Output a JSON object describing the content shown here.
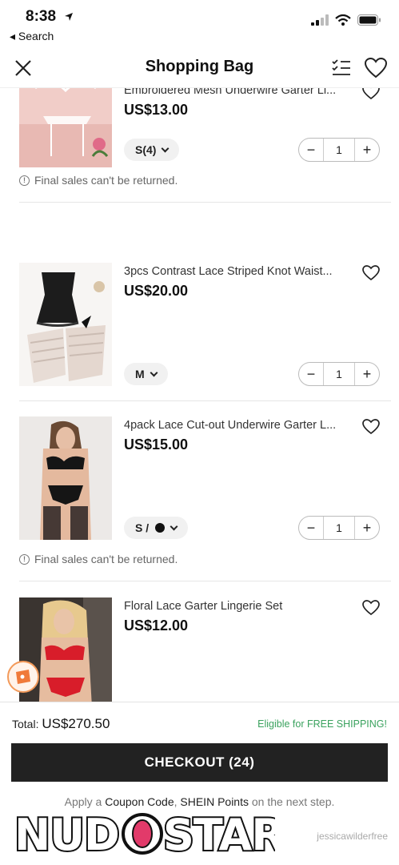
{
  "status_bar": {
    "time": "8:38",
    "back_label": "◂ Search"
  },
  "header": {
    "title": "Shopping Bag"
  },
  "items": [
    {
      "name": "Embroidered Mesh Underwire Garter Li...",
      "price": "US$13.00",
      "size": "S(4)",
      "quantity": "1",
      "notice": "Final sales can't be returned."
    },
    {
      "name": "3pcs Contrast Lace Striped Knot Waist...",
      "price": "US$20.00",
      "size": "M",
      "quantity": "1"
    },
    {
      "name": "4pack Lace Cut-out Underwire Garter L...",
      "price": "US$15.00",
      "size": "S /",
      "quantity": "1",
      "notice": "Final sales can't be returned."
    },
    {
      "name": "Floral Lace Garter Lingerie Set",
      "price": "US$12.00"
    }
  ],
  "footer": {
    "total_label": "Total:",
    "total_value": "US$270.50",
    "shipping_note": "Eligible for FREE SHIPPING!",
    "checkout_label": "CHECKOUT (24)",
    "apply_prefix": "Apply a ",
    "apply_coupon": "Coupon Code",
    "apply_sep": ", ",
    "apply_points": "SHEIN Points",
    "apply_suffix": " on the next step."
  },
  "watermark": {
    "brand": "NUDOSTAR",
    "user": "jessicawilderfree"
  },
  "colors": {
    "accent_green": "#3aa25e",
    "checkout_bg": "#222222",
    "badge_orange": "#f39a5a"
  }
}
